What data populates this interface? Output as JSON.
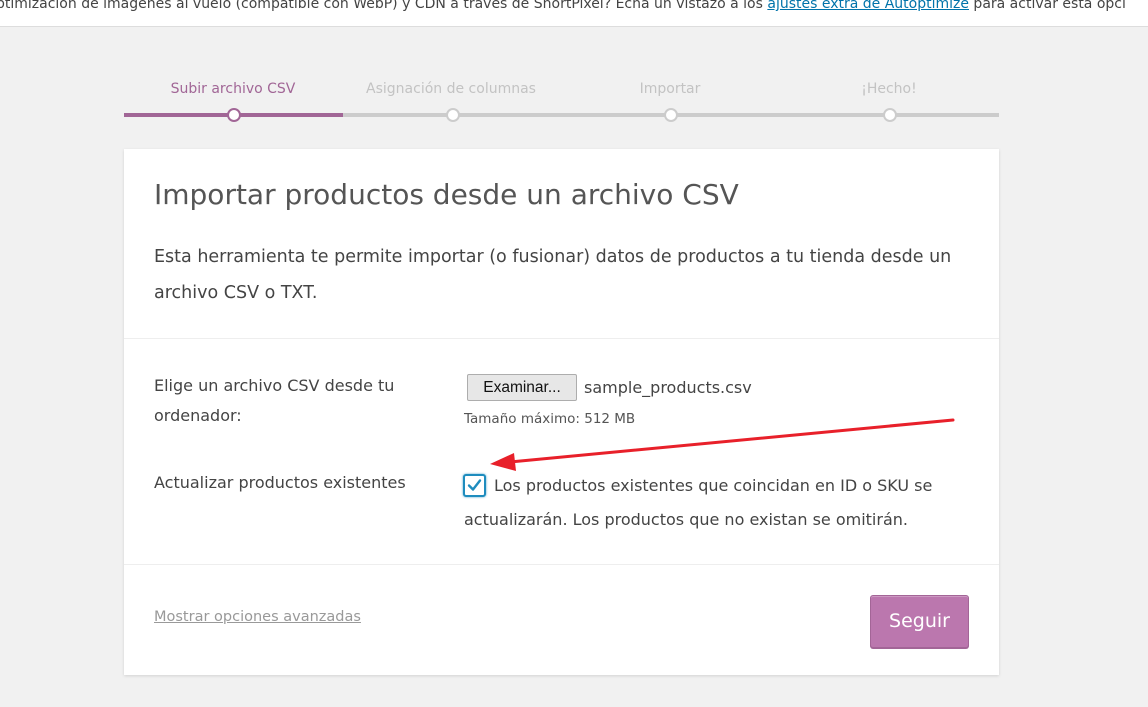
{
  "notice": {
    "text_before": "ptimización de imágenes al vuelo (compatible con WebP) y CDN a través de ShortPixel? Echa un vistazo a los ",
    "link_text": "ajustes extra de Autoptimize",
    "text_after": " para activar esta opci"
  },
  "steps": [
    {
      "label": "Subir archivo CSV"
    },
    {
      "label": "Asignación de columnas"
    },
    {
      "label": "Importar"
    },
    {
      "label": "¡Hecho!"
    }
  ],
  "card": {
    "title": "Importar productos desde un archivo CSV",
    "description": "Esta herramienta te permite importar (o fusionar) datos de productos a tu tienda desde un archivo CSV o TXT.",
    "file_label": "Elige un archivo CSV desde tu ordenador:",
    "browse_button": "Examinar...",
    "file_name": "sample_products.csv",
    "max_size": "Tamaño máximo: 512 MB",
    "update_label": "Actualizar productos existentes",
    "update_description": "Los productos existentes que coincidan en ID o SKU se actualizarán. Los productos que no existan se omitirán.",
    "update_checked": true,
    "advanced_link": "Mostrar opciones avanzadas",
    "continue_button": "Seguir"
  },
  "colors": {
    "accent": "#a16696",
    "button": "#bb77ae",
    "annotation_arrow": "#e8202a",
    "checkbox_focus": "#1e8cbe"
  }
}
